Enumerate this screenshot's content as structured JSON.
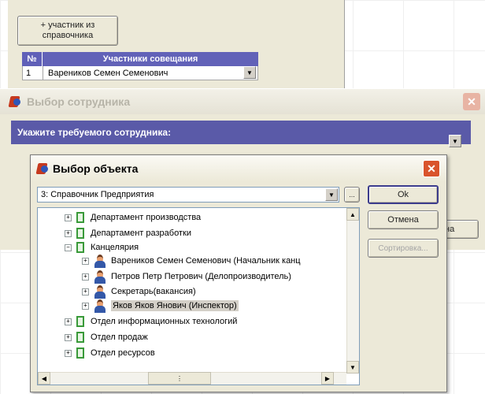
{
  "participants_window": {
    "add_button": "+ участник из справочника",
    "table": {
      "headers": {
        "num": "№",
        "participants": "Участники совещания"
      },
      "rows": [
        {
          "num": "1",
          "name": "Вареников Семен Семенович"
        }
      ]
    }
  },
  "employee_window": {
    "title": "Выбор сотрудника",
    "prompt": "Укажите требуемого сотрудника:",
    "partial_button": "на"
  },
  "object_dialog": {
    "title": "Выбор объекта",
    "combo_value": "3: Справочник Предприятия",
    "buttons": {
      "more": "...",
      "ok": "Ok",
      "cancel": "Отмена",
      "sort": "Сортировка..."
    },
    "tree": [
      {
        "label": "Департамент производства",
        "type": "folder",
        "level": 1,
        "expanded": false
      },
      {
        "label": "Департамент разработки",
        "type": "folder",
        "level": 1,
        "expanded": false
      },
      {
        "label": "Канцелярия",
        "type": "folder",
        "level": 1,
        "expanded": true
      },
      {
        "label": "Вареников Семен Семенович (Начальник канц",
        "type": "person",
        "level": 2,
        "expanded": false
      },
      {
        "label": "Петров Петр Петрович (Делопроизводитель)",
        "type": "person",
        "level": 2,
        "expanded": false
      },
      {
        "label": "Секретарь(вакансия)",
        "type": "person",
        "level": 2,
        "expanded": false
      },
      {
        "label": "Яков Яков Янович (Инспектор)",
        "type": "person",
        "level": 2,
        "expanded": false,
        "selected": true
      },
      {
        "label": "Отдел информационных технологий",
        "type": "folder",
        "level": 1,
        "expanded": false
      },
      {
        "label": "Отдел продаж",
        "type": "folder",
        "level": 1,
        "expanded": false
      },
      {
        "label": "Отдел ресурсов",
        "type": "folder",
        "level": 1,
        "expanded": false
      }
    ]
  },
  "colors": {
    "header_band": "#6060b8",
    "window_bg": "#ece9d8",
    "close_button": "#d9532c"
  }
}
